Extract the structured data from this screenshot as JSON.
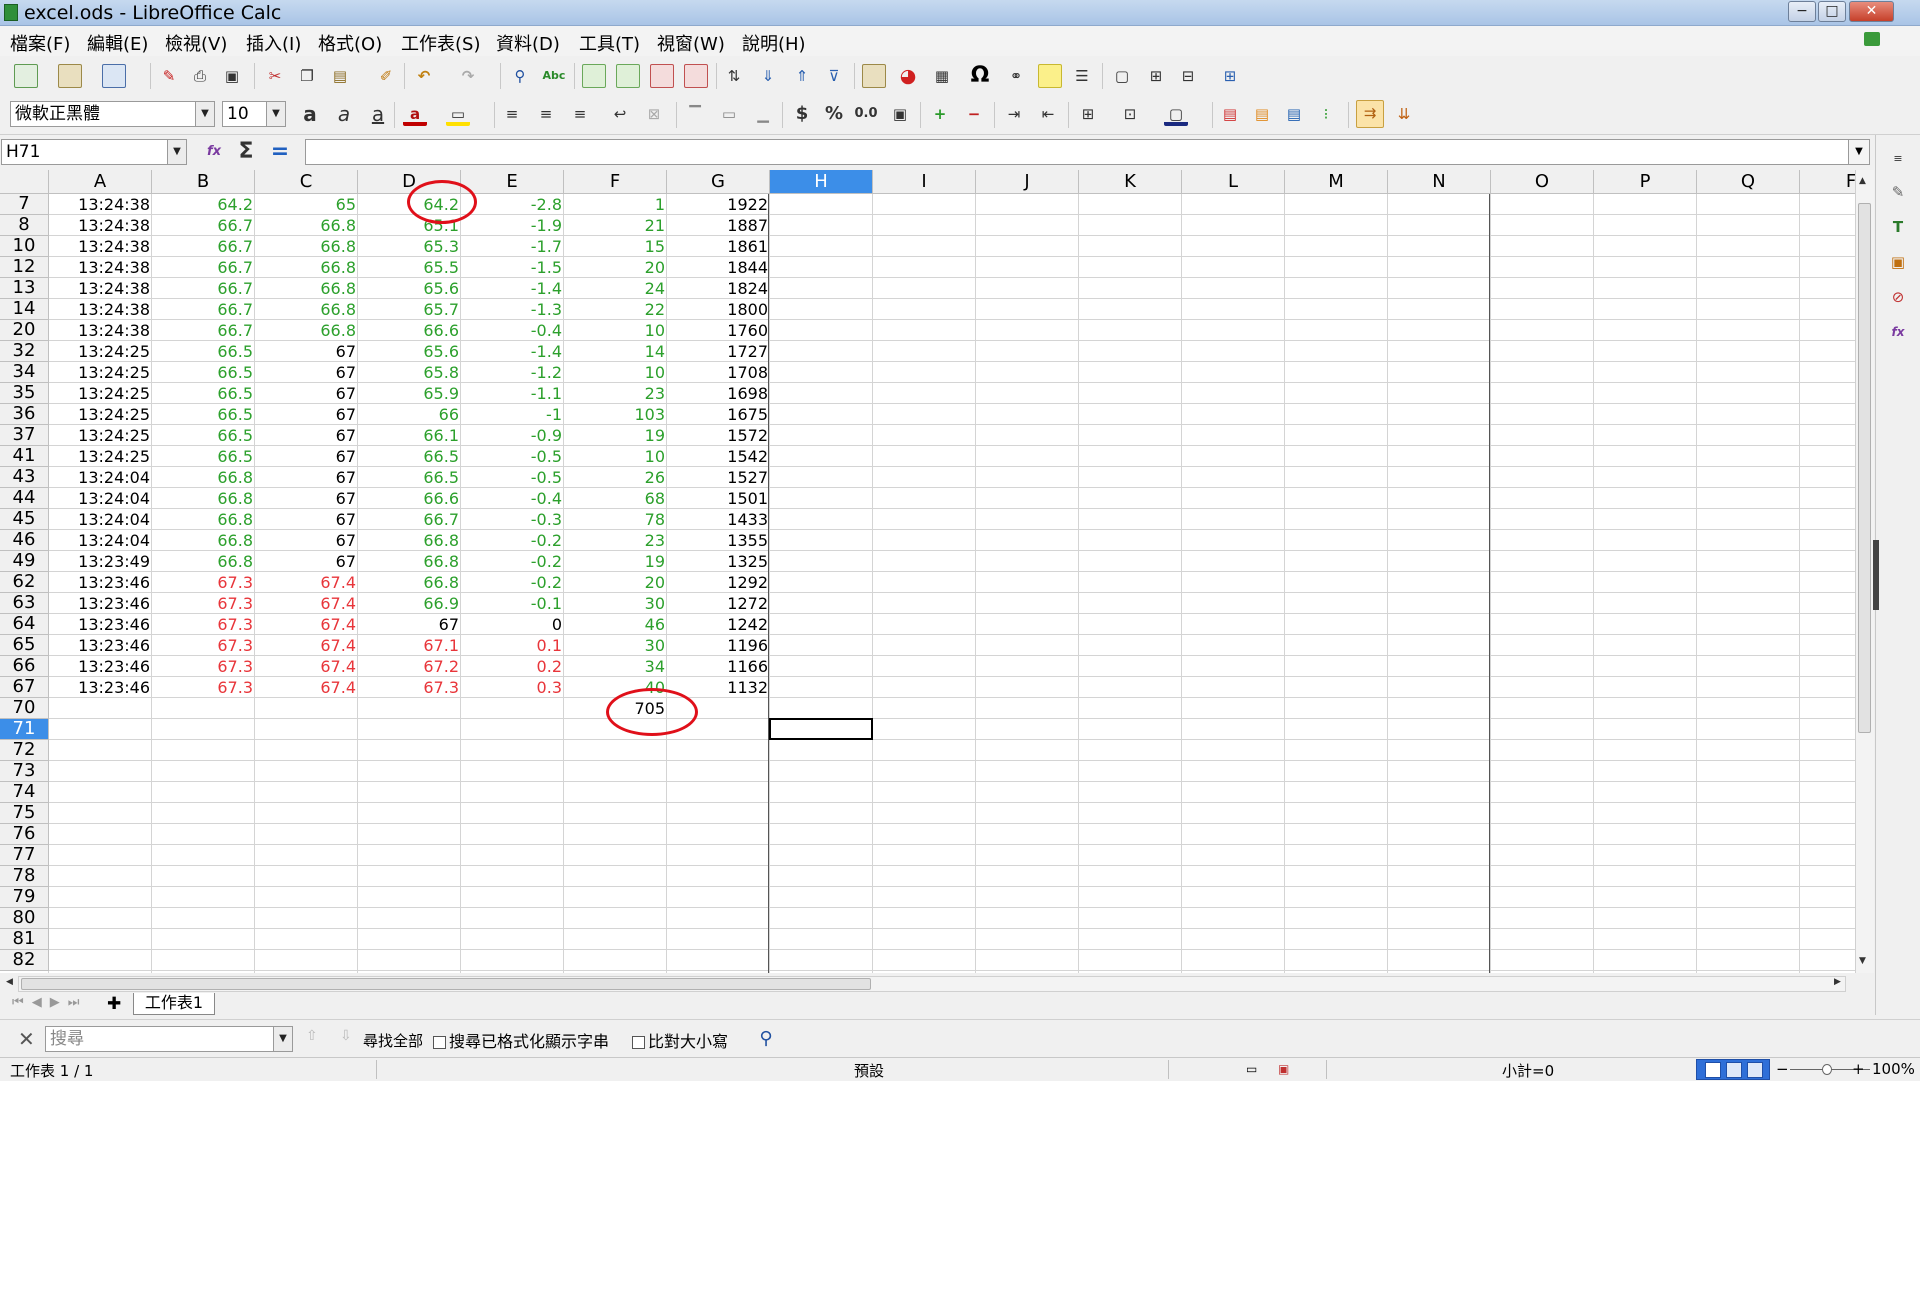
{
  "window": {
    "title": "excel.ods - LibreOffice Calc",
    "minimize": "−",
    "maximize": "□",
    "close": "✕"
  },
  "menu": [
    "檔案(F)",
    "編輯(E)",
    "檢視(V)",
    "插入(I)",
    "格式(O)",
    "工作表(S)",
    "資料(D)",
    "工具(T)",
    "視窗(W)",
    "說明(H)"
  ],
  "font_toolbar": {
    "font_name": "微軟正黑體",
    "font_size": "10",
    "currency": "$",
    "percent": "%",
    "decimal": "0.0"
  },
  "formula_bar": {
    "name_box": "H71",
    "formula": ""
  },
  "sheet": {
    "columns": [
      "A",
      "B",
      "C",
      "D",
      "E",
      "F",
      "G",
      "H",
      "I",
      "J",
      "K",
      "L",
      "M",
      "N",
      "O",
      "P",
      "Q",
      "F"
    ],
    "selected_column": "H",
    "selected_row": "71",
    "rows": [
      {
        "n": "7",
        "c": [
          "13:24:38",
          "64.2",
          "65",
          "64.2",
          "-2.8",
          "1",
          "1922"
        ]
      },
      {
        "n": "8",
        "c": [
          "13:24:38",
          "66.7",
          "66.8",
          "65.1",
          "-1.9",
          "21",
          "1887"
        ]
      },
      {
        "n": "10",
        "c": [
          "13:24:38",
          "66.7",
          "66.8",
          "65.3",
          "-1.7",
          "15",
          "1861"
        ]
      },
      {
        "n": "12",
        "c": [
          "13:24:38",
          "66.7",
          "66.8",
          "65.5",
          "-1.5",
          "20",
          "1844"
        ]
      },
      {
        "n": "13",
        "c": [
          "13:24:38",
          "66.7",
          "66.8",
          "65.6",
          "-1.4",
          "24",
          "1824"
        ]
      },
      {
        "n": "14",
        "c": [
          "13:24:38",
          "66.7",
          "66.8",
          "65.7",
          "-1.3",
          "22",
          "1800"
        ]
      },
      {
        "n": "20",
        "c": [
          "13:24:38",
          "66.7",
          "66.8",
          "66.6",
          "-0.4",
          "10",
          "1760"
        ]
      },
      {
        "n": "32",
        "c": [
          "13:24:25",
          "66.5",
          "67",
          "65.6",
          "-1.4",
          "14",
          "1727"
        ]
      },
      {
        "n": "34",
        "c": [
          "13:24:25",
          "66.5",
          "67",
          "65.8",
          "-1.2",
          "10",
          "1708"
        ]
      },
      {
        "n": "35",
        "c": [
          "13:24:25",
          "66.5",
          "67",
          "65.9",
          "-1.1",
          "23",
          "1698"
        ]
      },
      {
        "n": "36",
        "c": [
          "13:24:25",
          "66.5",
          "67",
          "66",
          "-1",
          "103",
          "1675"
        ]
      },
      {
        "n": "37",
        "c": [
          "13:24:25",
          "66.5",
          "67",
          "66.1",
          "-0.9",
          "19",
          "1572"
        ]
      },
      {
        "n": "41",
        "c": [
          "13:24:25",
          "66.5",
          "67",
          "66.5",
          "-0.5",
          "10",
          "1542"
        ]
      },
      {
        "n": "43",
        "c": [
          "13:24:04",
          "66.8",
          "67",
          "66.5",
          "-0.5",
          "26",
          "1527"
        ]
      },
      {
        "n": "44",
        "c": [
          "13:24:04",
          "66.8",
          "67",
          "66.6",
          "-0.4",
          "68",
          "1501"
        ]
      },
      {
        "n": "45",
        "c": [
          "13:24:04",
          "66.8",
          "67",
          "66.7",
          "-0.3",
          "78",
          "1433"
        ]
      },
      {
        "n": "46",
        "c": [
          "13:24:04",
          "66.8",
          "67",
          "66.8",
          "-0.2",
          "23",
          "1355"
        ]
      },
      {
        "n": "49",
        "c": [
          "13:23:49",
          "66.8",
          "67",
          "66.8",
          "-0.2",
          "19",
          "1325"
        ]
      },
      {
        "n": "62",
        "c": [
          "13:23:46",
          "67.3",
          "67.4",
          "66.8",
          "-0.2",
          "20",
          "1292"
        ]
      },
      {
        "n": "63",
        "c": [
          "13:23:46",
          "67.3",
          "67.4",
          "66.9",
          "-0.1",
          "30",
          "1272"
        ]
      },
      {
        "n": "64",
        "c": [
          "13:23:46",
          "67.3",
          "67.4",
          "67",
          "0",
          "46",
          "1242"
        ]
      },
      {
        "n": "65",
        "c": [
          "13:23:46",
          "67.3",
          "67.4",
          "67.1",
          "0.1",
          "30",
          "1196"
        ]
      },
      {
        "n": "66",
        "c": [
          "13:23:46",
          "67.3",
          "67.4",
          "67.2",
          "0.2",
          "34",
          "1166"
        ]
      },
      {
        "n": "67",
        "c": [
          "13:23:46",
          "67.3",
          "67.4",
          "67.3",
          "0.3",
          "40",
          "1132"
        ]
      },
      {
        "n": "70",
        "c": [
          "",
          "",
          "",
          "",
          "",
          "705",
          ""
        ]
      },
      {
        "n": "71",
        "c": [
          "",
          "",
          "",
          "",
          "",
          "",
          ""
        ]
      },
      {
        "n": "72",
        "c": [
          "",
          "",
          "",
          "",
          "",
          "",
          ""
        ]
      },
      {
        "n": "73",
        "c": [
          "",
          "",
          "",
          "",
          "",
          "",
          ""
        ]
      },
      {
        "n": "74",
        "c": [
          "",
          "",
          "",
          "",
          "",
          "",
          ""
        ]
      },
      {
        "n": "75",
        "c": [
          "",
          "",
          "",
          "",
          "",
          "",
          ""
        ]
      },
      {
        "n": "76",
        "c": [
          "",
          "",
          "",
          "",
          "",
          "",
          ""
        ]
      },
      {
        "n": "77",
        "c": [
          "",
          "",
          "",
          "",
          "",
          "",
          ""
        ]
      },
      {
        "n": "78",
        "c": [
          "",
          "",
          "",
          "",
          "",
          "",
          ""
        ]
      },
      {
        "n": "79",
        "c": [
          "",
          "",
          "",
          "",
          "",
          "",
          ""
        ]
      },
      {
        "n": "80",
        "c": [
          "",
          "",
          "",
          "",
          "",
          "",
          ""
        ]
      },
      {
        "n": "81",
        "c": [
          "",
          "",
          "",
          "",
          "",
          "",
          ""
        ]
      },
      {
        "n": "82",
        "c": [
          "",
          "",
          "",
          "",
          "",
          "",
          ""
        ]
      }
    ],
    "colors": {
      "green": "#2ca02c",
      "red": "#e8353a",
      "black": "#000000"
    },
    "sheet_tab": "工作表1",
    "add_sheet": "✚"
  },
  "find_bar": {
    "placeholder": "搜尋",
    "find_all": "尋找全部",
    "match_formatted": "搜尋已格式化顯示字串",
    "match_case": "比對大小寫"
  },
  "status_bar": {
    "sheet": "工作表 1 / 1",
    "style": "預設",
    "sum": "小計=0",
    "zoom": "100%"
  }
}
